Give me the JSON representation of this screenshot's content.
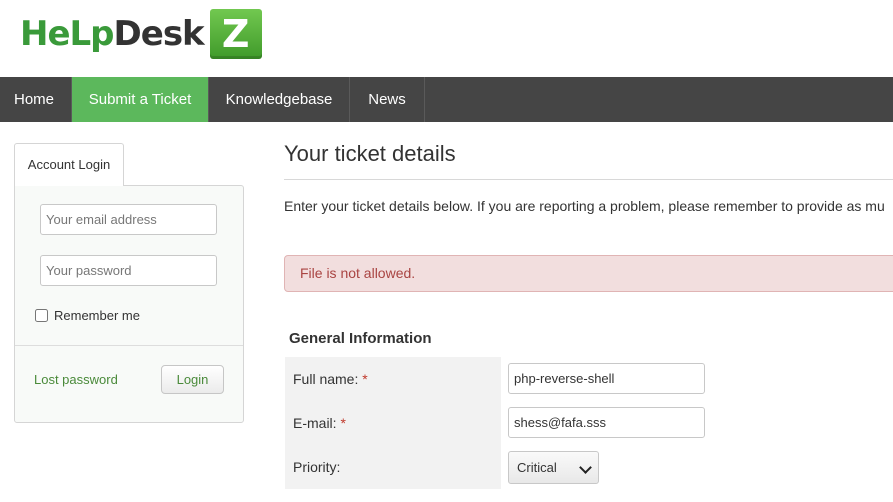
{
  "logo": {
    "part1": "HeLp",
    "part2": "Desk",
    "badge": "Z"
  },
  "nav": {
    "items": [
      {
        "label": "Home"
      },
      {
        "label": "Submit a Ticket"
      },
      {
        "label": "Knowledgebase"
      },
      {
        "label": "News"
      }
    ],
    "active_color": "#5cb85c",
    "bg_color": "#454545"
  },
  "login": {
    "tab_label": "Account Login",
    "email_placeholder": "Your email address",
    "password_placeholder": "Your password",
    "remember_label": "Remember me",
    "remember_checked": false,
    "lost_password": "Lost password",
    "login_button": "Login"
  },
  "main": {
    "title": "Your ticket details",
    "intro": "Enter your ticket details below. If you are reporting a problem, please remember to provide as mu",
    "alert": "File is not allowed.",
    "section_title": "General Information",
    "fields": {
      "full_name_label": "Full name:",
      "full_name_value": "php-reverse-shell",
      "email_label": "E-mail:",
      "email_value": "shess@fafa.sss",
      "priority_label": "Priority:",
      "priority_value": "Critical",
      "required_mark": "*"
    }
  }
}
